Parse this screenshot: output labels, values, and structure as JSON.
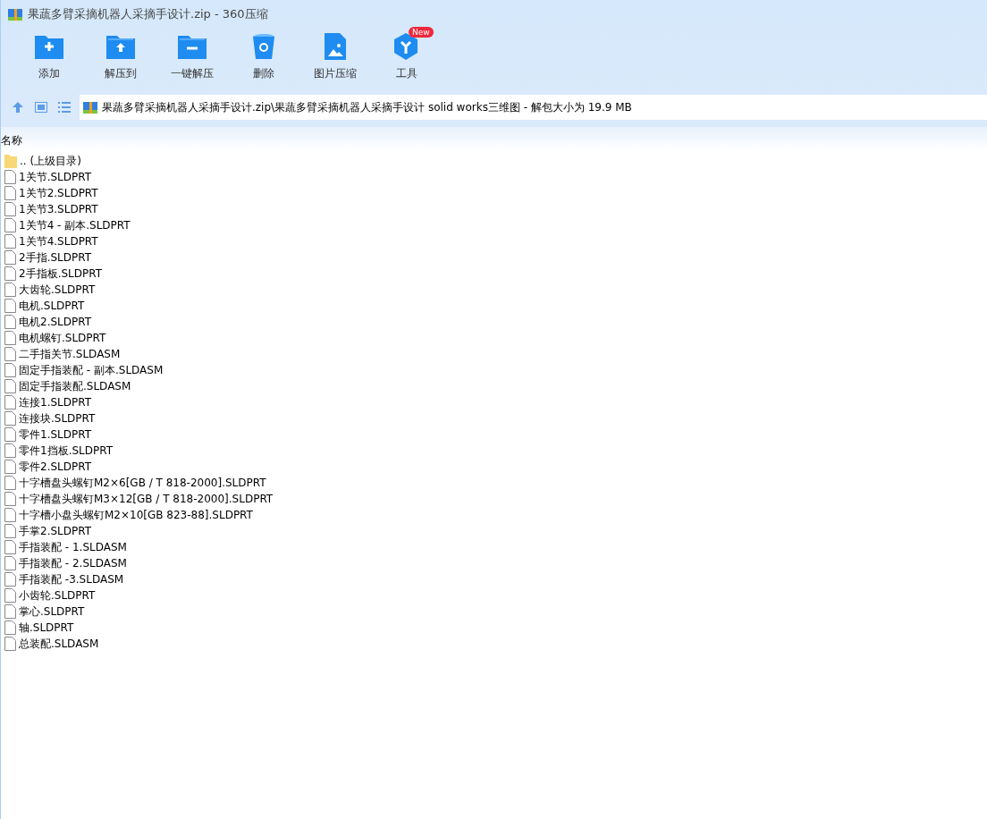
{
  "window": {
    "title": "果蔬多臂采摘机器人采摘手设计.zip - 360压缩"
  },
  "toolbar": [
    {
      "kind": "add",
      "label": "添加"
    },
    {
      "kind": "extract",
      "label": "解压到"
    },
    {
      "kind": "onekey",
      "label": "一键解压"
    },
    {
      "kind": "delete",
      "label": "删除"
    },
    {
      "kind": "image",
      "label": "图片压缩"
    },
    {
      "kind": "tools",
      "label": "工具",
      "badge": "New"
    }
  ],
  "address": {
    "path": "果蔬多臂采摘机器人采摘手设计.zip\\果蔬多臂采摘机器人采摘手设计 solid works三维图 - 解包大小为 19.9 MB"
  },
  "table": {
    "columns": [
      "名称"
    ],
    "rows": [
      {
        "kind": "folder",
        "name": ".. (上级目录)"
      },
      {
        "kind": "file",
        "name": "1关节.SLDPRT"
      },
      {
        "kind": "file",
        "name": "1关节2.SLDPRT"
      },
      {
        "kind": "file",
        "name": "1关节3.SLDPRT"
      },
      {
        "kind": "file",
        "name": "1关节4 - 副本.SLDPRT"
      },
      {
        "kind": "file",
        "name": "1关节4.SLDPRT"
      },
      {
        "kind": "file",
        "name": "2手指.SLDPRT"
      },
      {
        "kind": "file",
        "name": "2手指板.SLDPRT"
      },
      {
        "kind": "file",
        "name": "大齿轮.SLDPRT"
      },
      {
        "kind": "file",
        "name": "电机.SLDPRT"
      },
      {
        "kind": "file",
        "name": "电机2.SLDPRT"
      },
      {
        "kind": "file",
        "name": "电机螺钉.SLDPRT"
      },
      {
        "kind": "file",
        "name": "二手指关节.SLDASM"
      },
      {
        "kind": "file",
        "name": "固定手指装配 - 副本.SLDASM"
      },
      {
        "kind": "file",
        "name": "固定手指装配.SLDASM"
      },
      {
        "kind": "file",
        "name": "连接1.SLDPRT"
      },
      {
        "kind": "file",
        "name": "连接块.SLDPRT"
      },
      {
        "kind": "file",
        "name": "零件1.SLDPRT"
      },
      {
        "kind": "file",
        "name": "零件1挡板.SLDPRT"
      },
      {
        "kind": "file",
        "name": "零件2.SLDPRT"
      },
      {
        "kind": "file",
        "name": "十字槽盘头螺钉M2×6[GB / T 818-2000].SLDPRT"
      },
      {
        "kind": "file",
        "name": "十字槽盘头螺钉M3×12[GB / T 818-2000].SLDPRT"
      },
      {
        "kind": "file",
        "name": "十字槽小盘头螺钉M2×10[GB 823-88].SLDPRT"
      },
      {
        "kind": "file",
        "name": "手掌2.SLDPRT"
      },
      {
        "kind": "file",
        "name": "手指装配 - 1.SLDASM"
      },
      {
        "kind": "file",
        "name": "手指装配 - 2.SLDASM"
      },
      {
        "kind": "file",
        "name": "手指装配 -3.SLDASM"
      },
      {
        "kind": "file",
        "name": "小齿轮.SLDPRT"
      },
      {
        "kind": "file",
        "name": "掌心.SLDPRT"
      },
      {
        "kind": "file",
        "name": "轴.SLDPRT"
      },
      {
        "kind": "file",
        "name": "总装配.SLDASM"
      }
    ]
  }
}
